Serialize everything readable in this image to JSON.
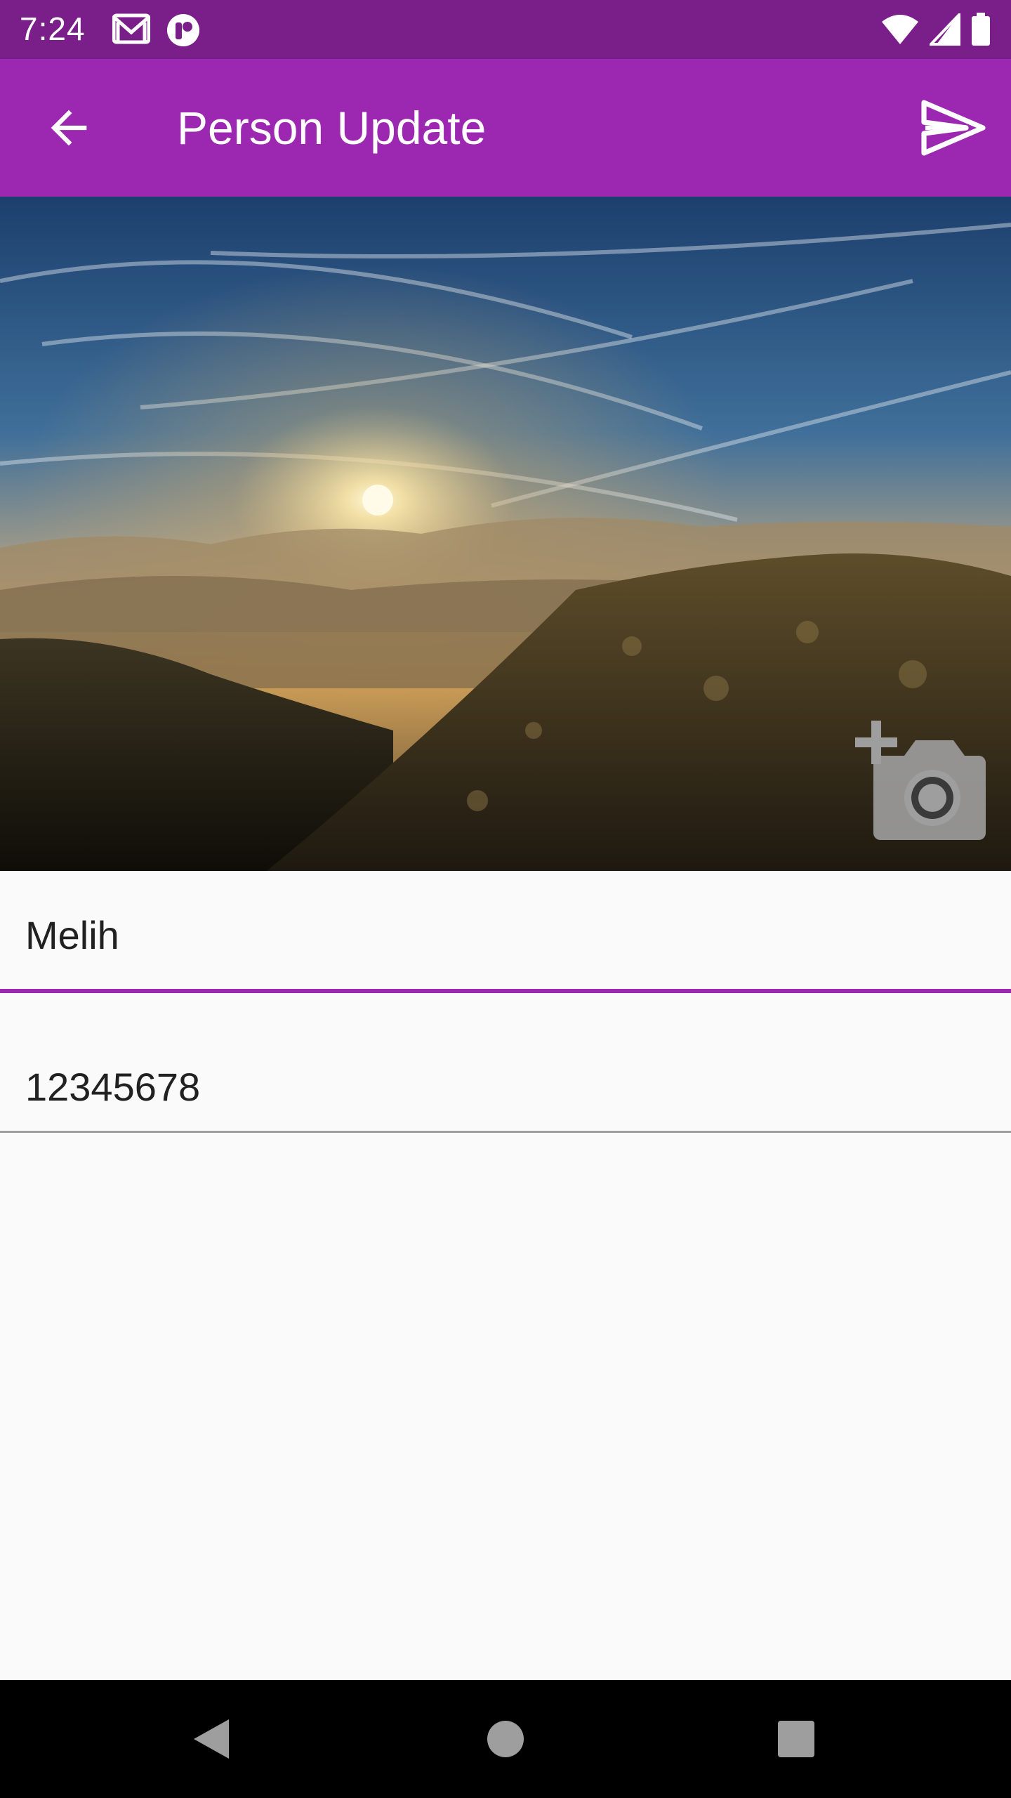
{
  "status_bar": {
    "time": "7:24",
    "left_icons": [
      "gmail-icon",
      "notification-app-icon"
    ],
    "right_icons": [
      "wifi-icon",
      "cellular-signal-icon",
      "battery-icon"
    ]
  },
  "app_bar": {
    "title": "Person Update",
    "back_icon": "arrow-back-icon",
    "action_icon": "send-icon",
    "color": "#9c27b0"
  },
  "hero_image": {
    "description_icon": "mountain-sunrise-photo",
    "add_photo_icon": "add-a-photo-icon"
  },
  "form": {
    "name_value": "Melih",
    "phone_value": "12345678",
    "focused_field_color": "#9c27b0"
  },
  "nav_bar": {
    "buttons": [
      "back-triangle-icon",
      "home-circle-icon",
      "recents-square-icon"
    ]
  }
}
